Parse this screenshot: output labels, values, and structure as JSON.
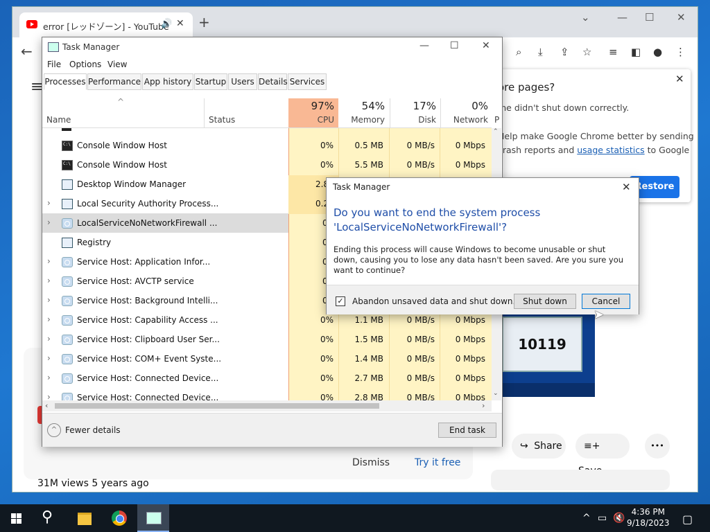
{
  "browser": {
    "tab_title": "error [レッドゾーン] - YouTube",
    "toolbar_icons": [
      "search-icon",
      "download-icon",
      "share-icon",
      "star-icon",
      "media-icon",
      "sidebar-icon",
      "profile-icon",
      "menu-icon"
    ],
    "restore_bubble": {
      "title": "ore pages?",
      "line1": "me didn't shut down correctly.",
      "line2": "Help make Google Chrome better by sending",
      "line3_pre": "crash reports and ",
      "line3_link": "usage statistics",
      "line3_post": " to Google",
      "restore_label": "Restore"
    },
    "video": {
      "thumb_text": "10119",
      "share_label": "Share",
      "save_label": "Save",
      "more_label": "•••",
      "views": "31M views  5 years ago",
      "dismiss_label": "Dismiss",
      "try_label": "Try it free"
    }
  },
  "taskmgr": {
    "title": "Task Manager",
    "menu": [
      "File",
      "Options",
      "View"
    ],
    "tabs": [
      "Processes",
      "Performance",
      "App history",
      "Startup",
      "Users",
      "Details",
      "Services"
    ],
    "columns": {
      "name": "Name",
      "status": "Status",
      "cpu_pct": "97%",
      "cpu": "CPU",
      "mem_pct": "54%",
      "mem": "Memory",
      "disk_pct": "17%",
      "disk": "Disk",
      "net_pct": "0%",
      "net": "Network",
      "power": "P"
    },
    "rows": [
      {
        "name": "Console Window Host",
        "cpu": "0%",
        "mem": "0.5 MB",
        "disk": "0 MB/s",
        "net": "0 Mbps"
      },
      {
        "name": "Console Window Host",
        "cpu": "0%",
        "mem": "5.5 MB",
        "disk": "0 MB/s",
        "net": "0 Mbps"
      },
      {
        "name": "Desktop Window Manager",
        "cpu": "2.8",
        "mem": "",
        "disk": "",
        "net": ""
      },
      {
        "name": "Local Security Authority Process...",
        "cpu": "0.2",
        "mem": "",
        "disk": "",
        "net": ""
      },
      {
        "name": "LocalServiceNoNetworkFirewall ...",
        "cpu": "0",
        "mem": "",
        "disk": "",
        "net": ""
      },
      {
        "name": "Registry",
        "cpu": "0",
        "mem": "",
        "disk": "",
        "net": ""
      },
      {
        "name": "Service Host: Application Infor...",
        "cpu": "0",
        "mem": "",
        "disk": "",
        "net": ""
      },
      {
        "name": "Service Host: AVCTP service",
        "cpu": "0",
        "mem": "",
        "disk": "",
        "net": ""
      },
      {
        "name": "Service Host: Background Intelli...",
        "cpu": "0",
        "mem": "",
        "disk": "",
        "net": ""
      },
      {
        "name": "Service Host: Capability Access ...",
        "cpu": "0%",
        "mem": "1.1 MB",
        "disk": "0 MB/s",
        "net": "0 Mbps"
      },
      {
        "name": "Service Host: Clipboard User Ser...",
        "cpu": "0%",
        "mem": "1.5 MB",
        "disk": "0 MB/s",
        "net": "0 Mbps"
      },
      {
        "name": "Service Host: COM+ Event Syste...",
        "cpu": "0%",
        "mem": "1.4 MB",
        "disk": "0 MB/s",
        "net": "0 Mbps"
      },
      {
        "name": "Service Host: Connected Device...",
        "cpu": "0%",
        "mem": "2.7 MB",
        "disk": "0 MB/s",
        "net": "0 Mbps"
      },
      {
        "name": "Service Host: Connected Device...",
        "cpu": "0%",
        "mem": "2.8 MB",
        "disk": "0 MB/s",
        "net": "0 Mbps"
      }
    ],
    "fewer_details": "Fewer details",
    "end_task": "End task"
  },
  "dialog": {
    "title": "Task Manager",
    "heading_line1": "Do you want to end the system process",
    "heading_line2": "'LocalServiceNoNetworkFirewall'?",
    "body": "Ending this process will cause Windows to become unusable or shut down, causing you to lose any data hasn't been saved. Are you sure you want to continue?",
    "checkbox_label": "Abandon unsaved data and shut down.",
    "checkbox_checked": true,
    "shutdown_label": "Shut down",
    "cancel_label": "Cancel"
  },
  "taskbar": {
    "time": "4:36 PM",
    "date": "9/18/2023"
  }
}
